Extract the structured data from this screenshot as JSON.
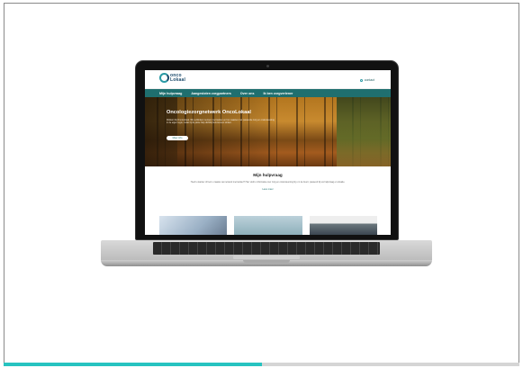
{
  "colors": {
    "teal_accent": "#27c3c0",
    "progress_track": "#d5d5d5",
    "nav_green": "#1f6f6f",
    "border": "#8a8a8a"
  },
  "progress": {
    "fraction": 0.5
  },
  "site": {
    "logo": {
      "icon": "onco-ring-logo",
      "line1": "onco",
      "line2": "Lokaal"
    },
    "contact": "contact",
    "nav": [
      "Mijn hulpvraag",
      "Aangesloten zorgpartners",
      "Over ons",
      "Ik ben zorgverlener"
    ],
    "hero": {
      "title": "Oncologiezorgnetwerk OncoLokaal",
      "text": "Welkom bij OncoLokaal. Wij verbinden mensen met kanker en hun naasten met passende zorg en ondersteuning in de eigen regio, zodat zij de juiste hulp dichtbij huis kunnen vinden.",
      "button": "Meer info"
    },
    "section": {
      "title": "Mijn hulpvraag",
      "text": "Heeft u kanker of bent u naaste van iemand met kanker? Hier vindt u informatie over zorg en ondersteuning bij u in de buurt, passend bij uw hulpvraag en situatie.",
      "link": "Lees meer"
    }
  }
}
